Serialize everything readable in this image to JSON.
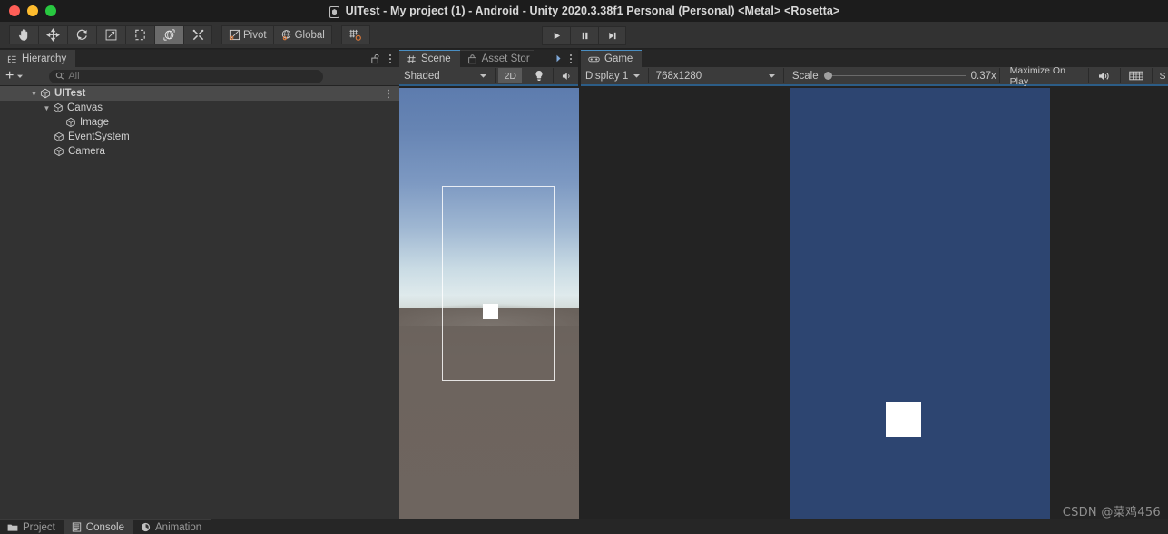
{
  "window": {
    "title": "UITest - My project (1) - Android - Unity 2020.3.38f1 Personal (Personal) <Metal> <Rosetta>",
    "traffic_lights": [
      "close",
      "minimize",
      "zoom"
    ],
    "logo_icon": "unity-logo-icon"
  },
  "toolbar": {
    "tools": [
      {
        "name": "hand-tool",
        "icon": "hand-icon",
        "active": false
      },
      {
        "name": "move-tool",
        "icon": "move-arrows-icon",
        "active": false
      },
      {
        "name": "rotate-tool",
        "icon": "rotate-icon",
        "active": false
      },
      {
        "name": "scale-tool",
        "icon": "scale-icon",
        "active": false
      },
      {
        "name": "rect-tool",
        "icon": "rect-transform-icon",
        "active": false
      },
      {
        "name": "transform-tool",
        "icon": "transform-gizmo-icon",
        "active": true
      },
      {
        "name": "custom-editor-tool",
        "icon": "wrench-hammer-icon",
        "active": false
      }
    ],
    "pivot_label": "Pivot",
    "pivot_icon": "pivot-icon",
    "global_label": "Global",
    "global_icon": "globe-icon",
    "snap_icon": "grid-snap-icon",
    "play_controls": [
      {
        "name": "play-button",
        "icon": "play-icon"
      },
      {
        "name": "pause-button",
        "icon": "pause-icon"
      },
      {
        "name": "step-button",
        "icon": "step-icon"
      }
    ]
  },
  "hierarchy": {
    "tab_label": "Hierarchy",
    "tab_icon": "hierarchy-icon",
    "lock_icon": "lock-open-icon",
    "menu_icon": "kebab-menu-icon",
    "add_label": "+",
    "add_dropdown_icon": "chevron-down-icon",
    "search": {
      "placeholder": "All",
      "value": "",
      "icon": "search-icon"
    },
    "tree": [
      {
        "label": "UITest",
        "depth": 0,
        "icon": "scene-icon",
        "expanded": true,
        "selected": true,
        "has_menu": true
      },
      {
        "label": "Canvas",
        "depth": 1,
        "icon": "gameobject-icon",
        "expanded": true,
        "selected": false,
        "has_menu": false
      },
      {
        "label": "Image",
        "depth": 2,
        "icon": "gameobject-icon",
        "expanded": null,
        "selected": false,
        "has_menu": false
      },
      {
        "label": "EventSystem",
        "depth": 1,
        "icon": "gameobject-icon",
        "expanded": null,
        "selected": false,
        "has_menu": false
      },
      {
        "label": "Camera",
        "depth": 1,
        "icon": "gameobject-icon",
        "expanded": null,
        "selected": false,
        "has_menu": false
      }
    ]
  },
  "scene_panel": {
    "tabs": [
      {
        "label": "Scene",
        "icon": "scene-grid-icon",
        "active": true
      },
      {
        "label": "Asset Stor",
        "icon": "asset-store-icon",
        "active": false
      }
    ],
    "overflow_icon": "chevron-right-icon",
    "menu_icon": "kebab-menu-icon",
    "draw_mode": "Shaded",
    "draw_mode_icon": "chevron-down-icon",
    "toggle_2d": "2D",
    "lighting_icon": "light-bulb-icon",
    "audio_icon": "speaker-icon"
  },
  "game_panel": {
    "tab": {
      "label": "Game",
      "icon": "gamepad-icon",
      "active": true
    },
    "display": "Display 1",
    "display_icon": "chevron-down-icon",
    "resolution": "768x1280",
    "resolution_icon": "chevron-down-icon",
    "scale_label": "Scale",
    "scale_value": "0.37x",
    "scale_fraction": 0.03,
    "maximize_label": "Maximize On Play",
    "mute_icon": "speaker-icon",
    "gizmos_icon": "gizmos-grid-icon",
    "stats_label": "S"
  },
  "bottom_tabs": [
    {
      "label": "Project",
      "icon": "folder-icon",
      "active": false
    },
    {
      "label": "Console",
      "icon": "console-icon",
      "active": true
    },
    {
      "label": "Animation",
      "icon": "clock-icon",
      "active": false
    }
  ],
  "watermark": "CSDN @菜鸡456",
  "colors": {
    "panel_bg": "#323232",
    "toolbar_bg": "#3b3b3b",
    "dark_bg": "#232323",
    "tabbar_bg": "#262626",
    "accent_blue": "#2c5d87",
    "game_bg": "#2d4571",
    "selection": "#4a4a4a",
    "text": "#c8c8c8"
  }
}
